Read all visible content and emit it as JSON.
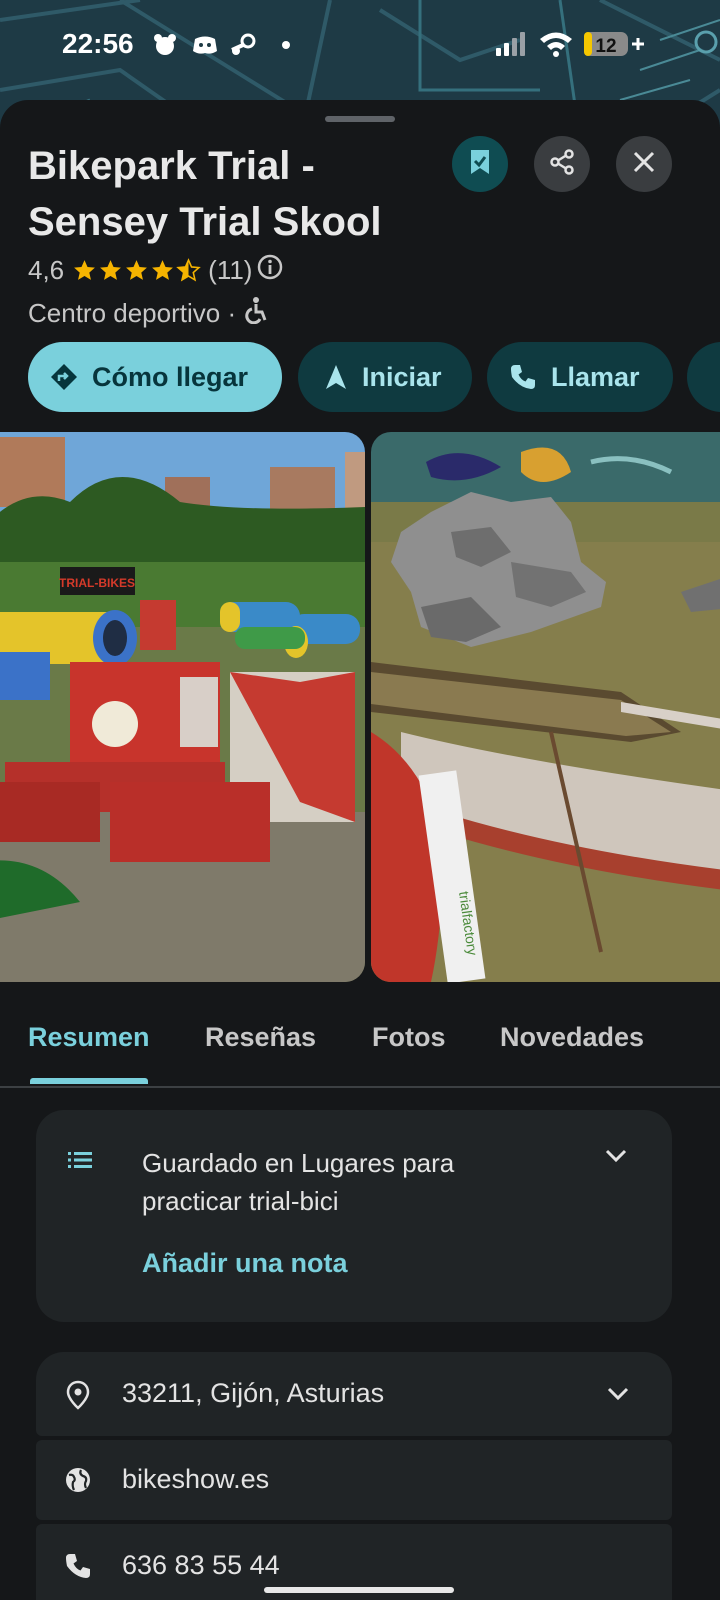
{
  "status_bar": {
    "time": "22:56",
    "battery": "12"
  },
  "place": {
    "title_line1": "Bikepark Trial -",
    "title_line2": "Sensey Trial Skool",
    "rating": "4,6",
    "review_count": "(11)",
    "category": "Centro deportivo ·"
  },
  "actions": {
    "directions": "Cómo llegar",
    "start": "Iniciar",
    "call": "Llamar"
  },
  "tabs": [
    "Resumen",
    "Reseñas",
    "Fotos",
    "Novedades"
  ],
  "saved": {
    "line1": "Guardado en Lugares para",
    "line2": "practicar trial-bici",
    "add_note": "Añadir una nota"
  },
  "details": {
    "address": "33211, Gijón, Asturias",
    "website": "bikeshow.es",
    "phone": "636 83 55 44"
  },
  "photo1": {
    "sign": "TRIAL-BIKES"
  },
  "photo2": {
    "banner": "trialfactory"
  },
  "colors": {
    "accent": "#7ad0dc",
    "background": "#151719",
    "card": "#202426",
    "star": "#f6b400"
  }
}
